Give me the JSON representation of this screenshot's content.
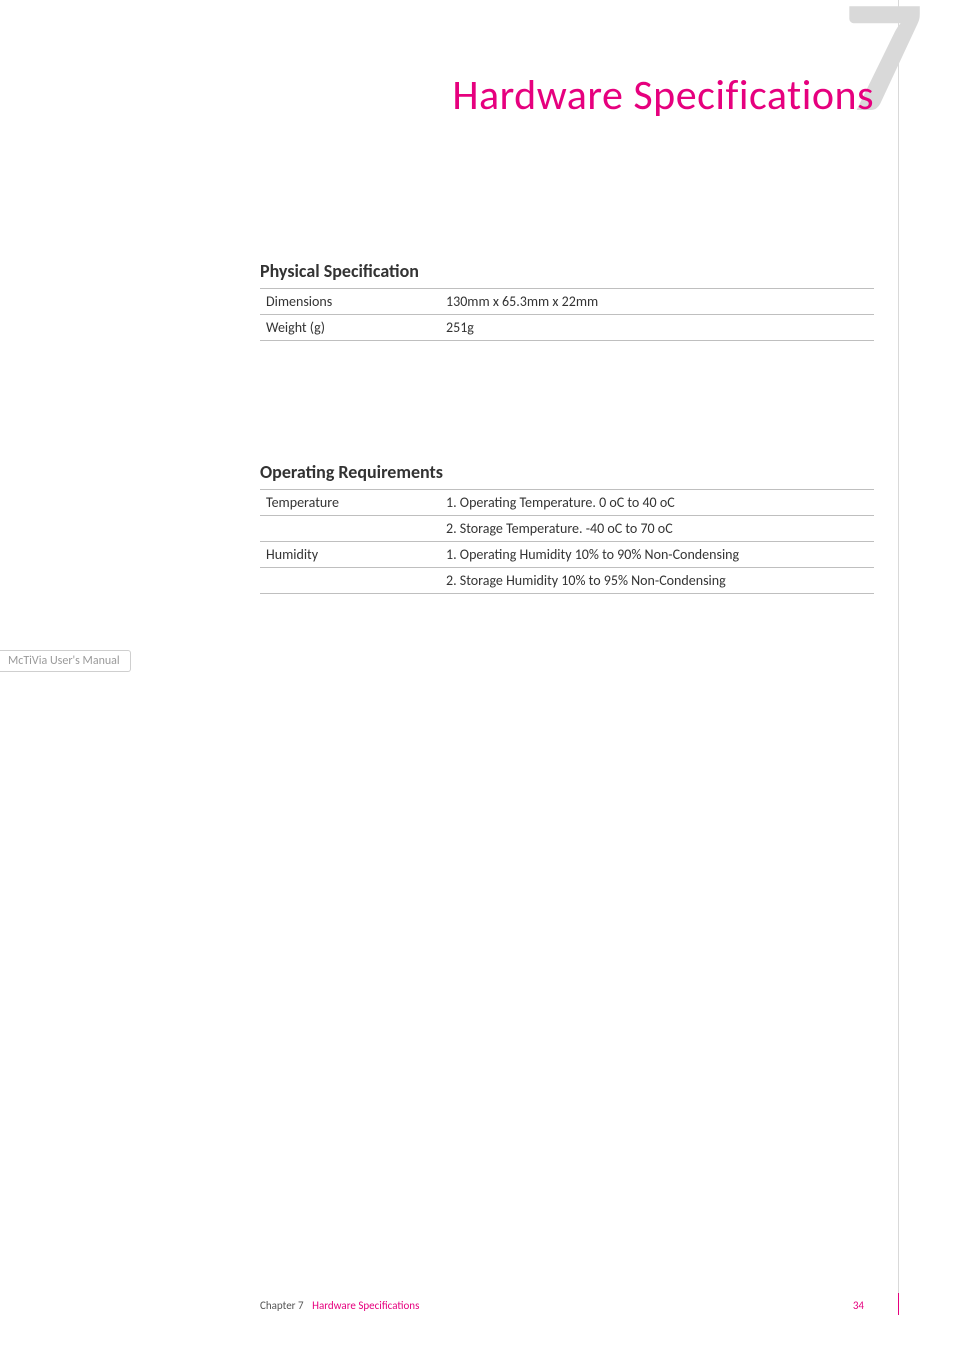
{
  "chapter_number_big": "7",
  "page_title": "Hardware Specifications",
  "left_tab": "McTiVia User's Manual",
  "sections": {
    "physical": {
      "heading": "Physical Specification",
      "rows": {
        "dimensions": {
          "key": "Dimensions",
          "value": "130mm x 65.3mm x 22mm"
        },
        "weight": {
          "key": "Weight (g)",
          "value": "251g"
        }
      }
    },
    "operating": {
      "heading": "Operating Requirements",
      "rows": {
        "temperature": {
          "key": "Temperature",
          "line1": "1. Operating Temperature. 0 oC to 40 oC",
          "line2": "2. Storage Temperature. -40 oC to 70 oC"
        },
        "humidity": {
          "key": "Humidity",
          "line1": "1. Operating Humidity 10% to 90% Non-Condensing",
          "line2": "2. Storage Humidity 10% to 95% Non-Condensing"
        }
      }
    }
  },
  "footer": {
    "chapter_label": "Chapter 7",
    "chapter_name": "Hardware Specifications",
    "page_number": "34"
  }
}
